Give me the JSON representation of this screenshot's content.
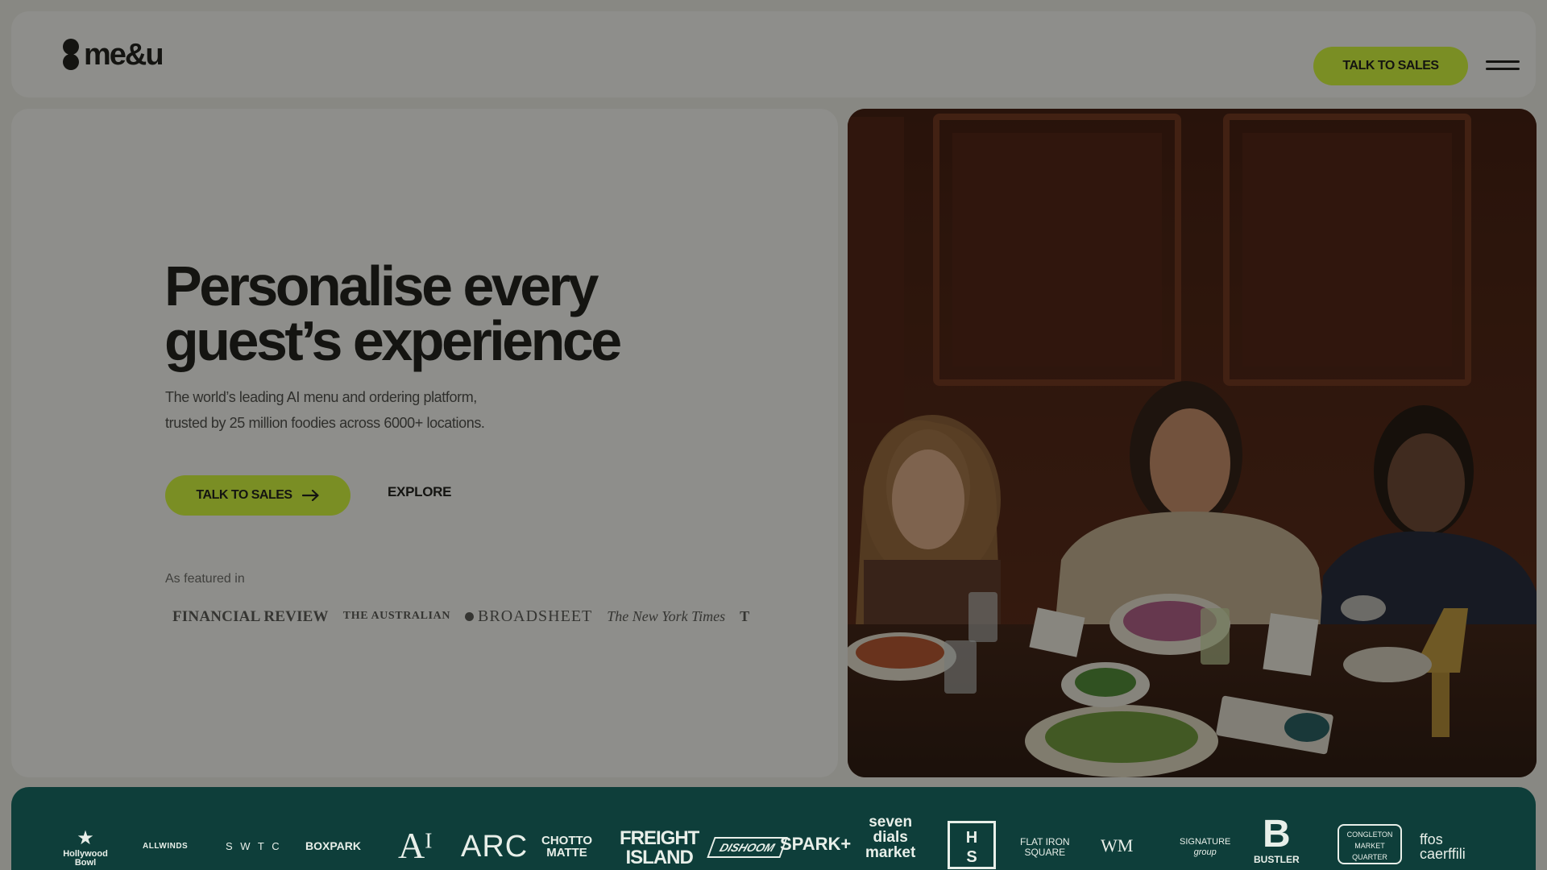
{
  "brand": {
    "logo_text": "me&u"
  },
  "header": {
    "cta_label": "TALK TO SALES",
    "menu_icon": "hamburger-icon"
  },
  "hero": {
    "title_line1": "Personalise every",
    "title_line2": "guest’s experience",
    "subtitle_line1": "The world’s leading AI menu and ordering platform,",
    "subtitle_line2": "trusted by 25 million foodies across 6000+ locations.",
    "cta_label": "TALK TO SALES",
    "cta_icon": "arrow-right-icon",
    "explore_label": "EXPLORE",
    "featured_label": "As featured in",
    "press": [
      {
        "name": "financial-review",
        "text": "FINANCIAL REVIEW"
      },
      {
        "name": "the-australian",
        "text": "THE AUSTRALIAN"
      },
      {
        "name": "broadsheet",
        "text": "BROADSHEET"
      },
      {
        "name": "new-york-times",
        "text": "The New York Times"
      },
      {
        "name": "t-logo",
        "text": "T"
      }
    ]
  },
  "image": {
    "subject": "three-diners-at-restaurant-table"
  },
  "clients": [
    {
      "name": "hollywood-bowl",
      "line1": "Hollywood",
      "line2": "Bowl"
    },
    {
      "name": "allwinds",
      "line1": "ALLWINDS"
    },
    {
      "name": "swtc",
      "line1": "S W T C"
    },
    {
      "name": "boxpark",
      "line1": "BOXPARK"
    },
    {
      "name": "ali-logo",
      "line1": "Aᴵ"
    },
    {
      "name": "arc",
      "line1": "ARC"
    },
    {
      "name": "chotto-matte",
      "line1": "CHOTTO",
      "line2": "MATTE"
    },
    {
      "name": "freight-island",
      "line1": "FREIGHT",
      "line2": "ISLAND"
    },
    {
      "name": "dishoom",
      "line1": "DISHOOM"
    },
    {
      "name": "spark",
      "line1": "SPARK+"
    },
    {
      "name": "seven-dials-market",
      "line1": "seven",
      "line2": "dials",
      "line3": "market"
    },
    {
      "name": "hs-logo",
      "line1": "H",
      "line2": "S"
    },
    {
      "name": "flat-iron-square",
      "line1": "FLAT IRON",
      "line2": "SQUARE"
    },
    {
      "name": "wm-logo",
      "line1": "WM"
    },
    {
      "name": "signature-group",
      "line1": "SIGNATURE",
      "line2": "group"
    },
    {
      "name": "bustler",
      "line1": "B",
      "line2": "BUSTLER"
    },
    {
      "name": "congleton-market",
      "line1": "CONGLETON",
      "line2": "MARKET",
      "line3": "QUARTER"
    },
    {
      "name": "ffos-caerffili",
      "line1": "ffos",
      "line2": "caerffili"
    }
  ],
  "colors": {
    "accent": "#d9ff3a",
    "page_bg": "#f3f3ef",
    "panel_bg": "#ffffff",
    "strip_bg": "#0e3e3a",
    "text": "#161616",
    "overlay": "rgba(18,18,12,0.48)"
  }
}
